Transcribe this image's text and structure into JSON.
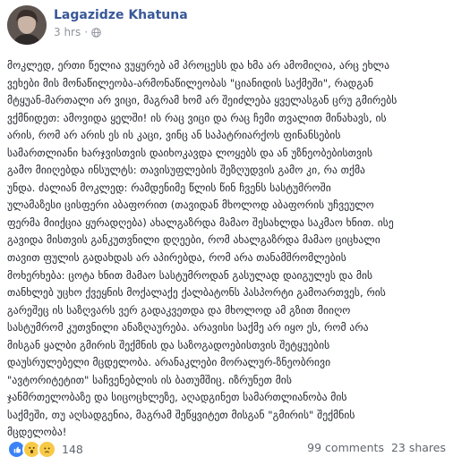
{
  "post": {
    "author": "Lagazidze Khatuna",
    "time": "3 hrs",
    "separator": "·",
    "lines": [
      "მოკლედ, ერთი წელია ვუყურებ ამ პროცესს და ხმა არ ამომიღია, არც ეხლა",
      "ვეხები მის მონაწილეობა-არმონაწილეობას \"ციანიდის საქმეში\", რადგან",
      "მტყუან-მართალი არ ვიცი, მაგრამ ხომ არ შეიძლება ყველასგან ცრუ გმირებს",
      "ვქმნიდეთ: ამოვიდა ყელში! ის რაც ვიცი და რაც ჩემი თვალით მინახავს, ის",
      "არის, რომ არ არის ეს ის კაცი, ვინც ან საპატრიარქოს ფინანსების",
      "სამართლიანი ხარჯვისთვის დაიხოკავდა ლოყებს და ან უზნეობებისთვის",
      "გამო მიიღებდა ინსულტს: თავისუფლების შეზღუდვის გამო კი, რა თქმა",
      "უნდა. ძალიან მოკლედ: რამდენიმე წლის წინ ჩვენს სასტუმროში",
      "ულამაზესი ცისფერი აბაფორით (თავიდან მხოლოდ აბაფორის უჩვეულო",
      "ფერმა მიიქცია ყურადღება) ახალგაზრდა მამაო შესახლდა საკმაო ხნით. ისე",
      "გავიდა მისთვის განკუთვნილი დღეები, რომ ახალგაზრდა მამაო ციცხალი",
      "თავით ფულის გადახდას არ აპირებდა, რომ არა თანამშრომლების",
      "მოხერხება: ცოტა ხნით მამაო სასტუმროდან გასულად დაიგულეს და მის",
      "თანხლებ უცხო ქვეყნის მოქალაქე ქალბატონს პასპორტი გამოართვეს, რის",
      "გარეშეც ის საზღვარს ვერ გადაკვეთდა და მხოლოდ ამ გზით მიიღო",
      "სასტუმრომ კუთვნილი ანაზღაურება. არავისი საქმე არ იყო ეს, რომ არა",
      "მისგან ყალბი გმირის შექმნის და საზოგადოებისთვის შეტყუების",
      "დაუსრულებელი მცდელობა. არანაკლები მორალურ-ზნეობრივი",
      "\"ავტორიტეტით\" საჩვენებლის ის ბათუმშიც. იზრუნეთ მის",
      "ჯანმრთელობაზე და სიცოცხლეზე, აღადგინეთ სამართლიანობა მის",
      "საქმეში, თუ აღსადგენია, მაგრამ შეწყვიტეთ მისგან \"გმირის\" შექმნის",
      "მცდელობა!"
    ]
  },
  "footer": {
    "reaction_count": "148",
    "comments": "99 comments",
    "shares": "23 shares",
    "reactions": [
      "like-icon",
      "wow-icon",
      "sad-icon"
    ]
  },
  "colors": {
    "author": "#385898",
    "meta": "#90949c",
    "text": "#1d2129",
    "like": "#3b82f6",
    "emoji": "#f7c948"
  }
}
